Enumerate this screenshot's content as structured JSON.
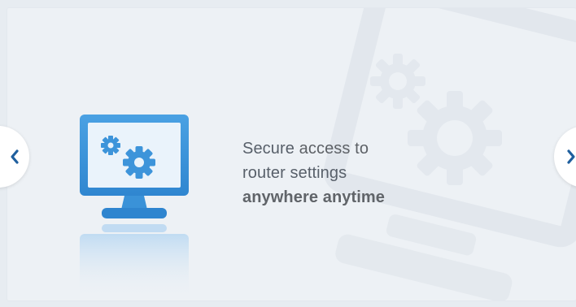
{
  "slide": {
    "text_line1_a": "Secure",
    "text_line1_b": "access to",
    "text_line2": "router settings",
    "text_line3": "anywhere anytime"
  },
  "navigation": {
    "prev_icon": "chevron-left-icon",
    "next_icon": "chevron-right-icon"
  },
  "colors": {
    "accent": "#1f6fb6",
    "monitor_blue": "#3f95d9",
    "background": "#edf1f5"
  }
}
